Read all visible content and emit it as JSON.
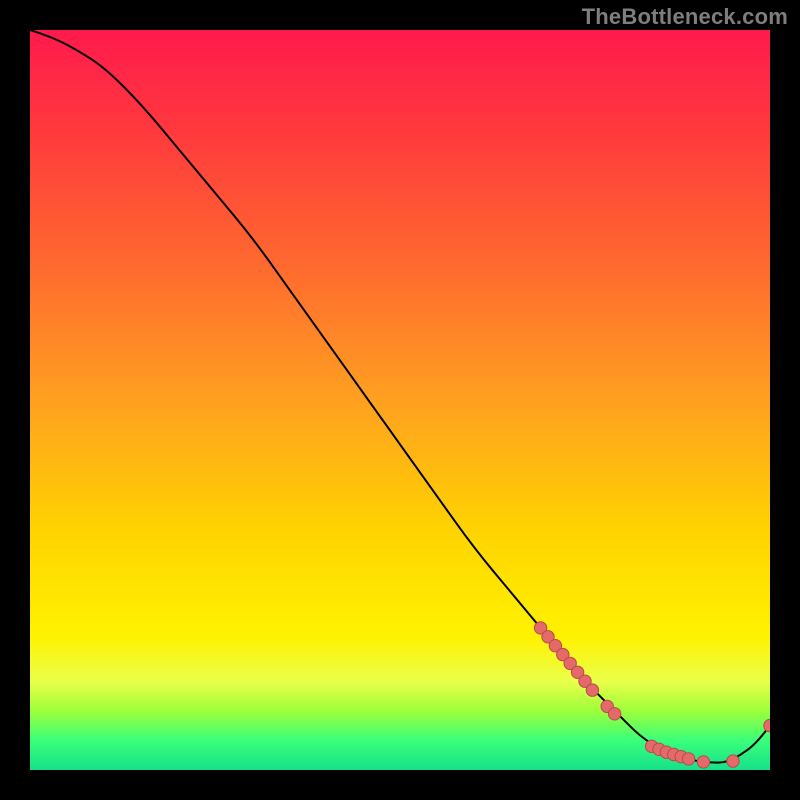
{
  "watermark": "TheBottleneck.com",
  "colors": {
    "curve": "#000000",
    "marker_fill": "#e46a6a",
    "marker_stroke": "#b94a4a",
    "gradient_top": "#ff1a4d",
    "gradient_bottom": "#16e08a"
  },
  "chart_data": {
    "type": "line",
    "title": "",
    "xlabel": "",
    "ylabel": "",
    "xlim": [
      0,
      100
    ],
    "ylim": [
      0,
      100
    ],
    "grid": false,
    "legend": false,
    "series": [
      {
        "name": "curve",
        "x": [
          0,
          3,
          6,
          10,
          15,
          20,
          25,
          30,
          35,
          40,
          45,
          50,
          55,
          60,
          65,
          70,
          72,
          75,
          78,
          80,
          82,
          84,
          86,
          88,
          90,
          92,
          94,
          96,
          98,
          100
        ],
        "y": [
          100,
          99,
          97.5,
          95,
          90,
          84,
          78,
          72,
          65,
          58,
          51,
          44,
          37,
          30,
          24,
          18,
          16,
          12,
          9,
          7,
          5,
          3.5,
          2.5,
          1.8,
          1.2,
          1,
          1,
          2,
          3.5,
          6
        ]
      }
    ],
    "markers": [
      {
        "x": 69,
        "y": 19.2
      },
      {
        "x": 70,
        "y": 18.0
      },
      {
        "x": 71,
        "y": 16.8
      },
      {
        "x": 72,
        "y": 15.6
      },
      {
        "x": 73,
        "y": 14.4
      },
      {
        "x": 74,
        "y": 13.2
      },
      {
        "x": 75,
        "y": 12.0
      },
      {
        "x": 76,
        "y": 10.8
      },
      {
        "x": 78,
        "y": 8.6
      },
      {
        "x": 79,
        "y": 7.6
      },
      {
        "x": 84,
        "y": 3.2
      },
      {
        "x": 85,
        "y": 2.8
      },
      {
        "x": 86,
        "y": 2.4
      },
      {
        "x": 87,
        "y": 2.1
      },
      {
        "x": 88,
        "y": 1.8
      },
      {
        "x": 89,
        "y": 1.5
      },
      {
        "x": 91,
        "y": 1.1
      },
      {
        "x": 95,
        "y": 1.2
      },
      {
        "x": 100,
        "y": 6.0
      }
    ]
  }
}
